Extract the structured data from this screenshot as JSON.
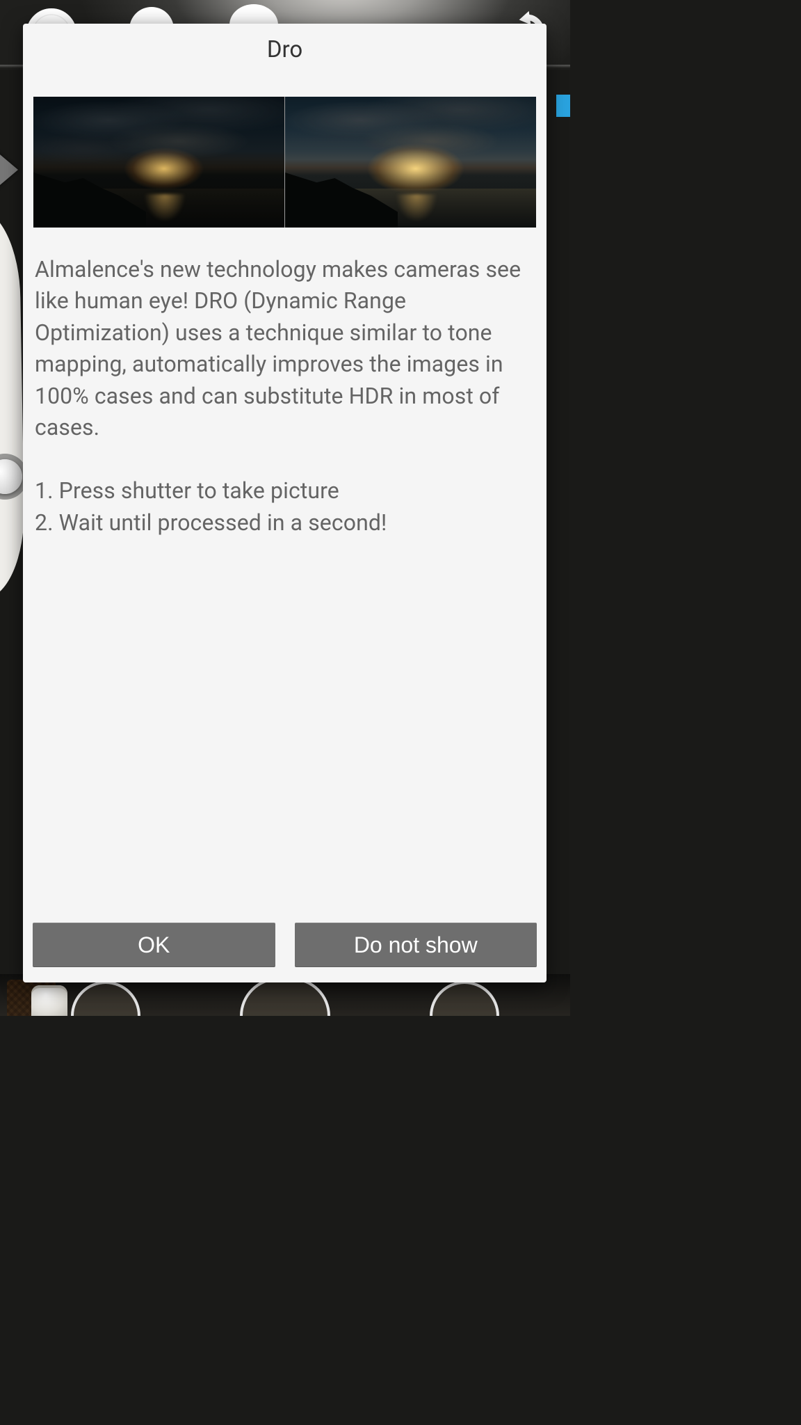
{
  "dialog": {
    "title": "Dro",
    "description": "Almalence's new technology makes cameras see like human eye! DRO (Dynamic Range Optimization) uses a technique similar to tone mapping, automatically improves the images in 100% cases and can substitute HDR in most of cases.",
    "steps": [
      "1. Press shutter to take picture",
      "2. Wait until processed in a second!"
    ],
    "ok_label": "OK",
    "dont_show_label": "Do not show"
  },
  "background": {
    "accent_color": "#2aa3df"
  }
}
